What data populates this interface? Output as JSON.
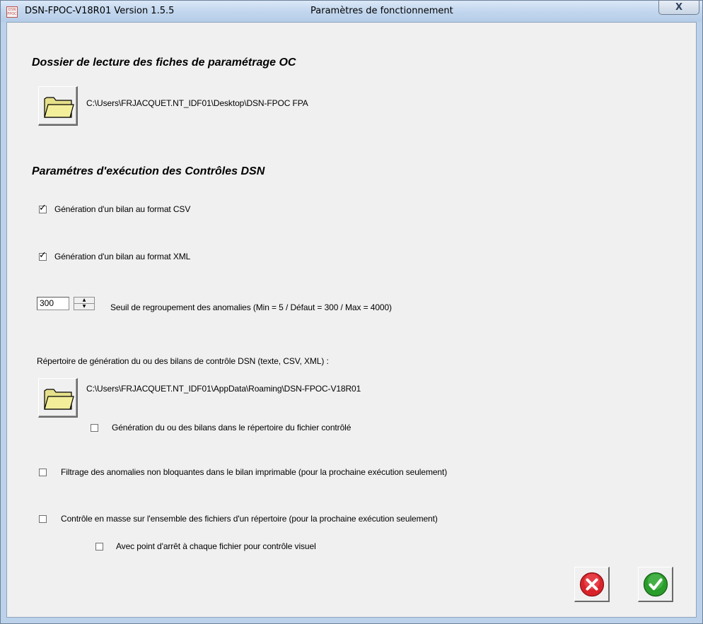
{
  "window": {
    "app_title": "DSN-FPOC-V18R01 Version 1.5.5",
    "dialog_title": "Paramètres de fonctionnement",
    "app_icon_text": "DSN FPOC",
    "close_symbol": "X"
  },
  "reading_folder": {
    "heading": "Dossier de lecture des fiches de paramétrage OC",
    "path": "C:\\Users\\FRJACQUET.NT_IDF01\\Desktop\\DSN-FPOC FPA",
    "icon": "folder-icon"
  },
  "execution": {
    "heading": "Paramétres d'exécution des Contrôles DSN",
    "csv": {
      "label": "Génération d'un bilan au format CSV",
      "checked": true
    },
    "xml": {
      "label": "Génération d'un bilan au format XML",
      "checked": true
    },
    "threshold": {
      "value": "300",
      "label": "Seuil de regroupement des anomalies (Min = 5 / Défaut = 300 / Max = 4000)"
    }
  },
  "output_folder": {
    "label": "Répertoire de génération du ou des bilans de contrôle DSN (texte, CSV, XML) :",
    "path": "C:\\Users\\FRJACQUET.NT_IDF01\\AppData\\Roaming\\DSN-FPOC-V18R01",
    "icon": "folder-icon",
    "same_dir": {
      "label": "Génération du ou des bilans dans le répertoire du fichier contrôlé",
      "checked": false
    }
  },
  "filter": {
    "label": "Filtrage des anomalies non bloquantes dans le bilan imprimable (pour la prochaine exécution seulement)",
    "checked": false
  },
  "mass_control": {
    "label": "Contrôle en masse sur l'ensemble des fichiers d'un répertoire (pour la prochaine exécution seulement)",
    "checked": false,
    "stop_point": {
      "label": "Avec point d'arrêt à chaque fichier pour contrôle visuel",
      "checked": false
    }
  },
  "actions": {
    "cancel_icon": "cancel-icon",
    "validate_icon": "validate-icon",
    "cancel_color": "#d9232b",
    "validate_color": "#2a9d2a"
  }
}
